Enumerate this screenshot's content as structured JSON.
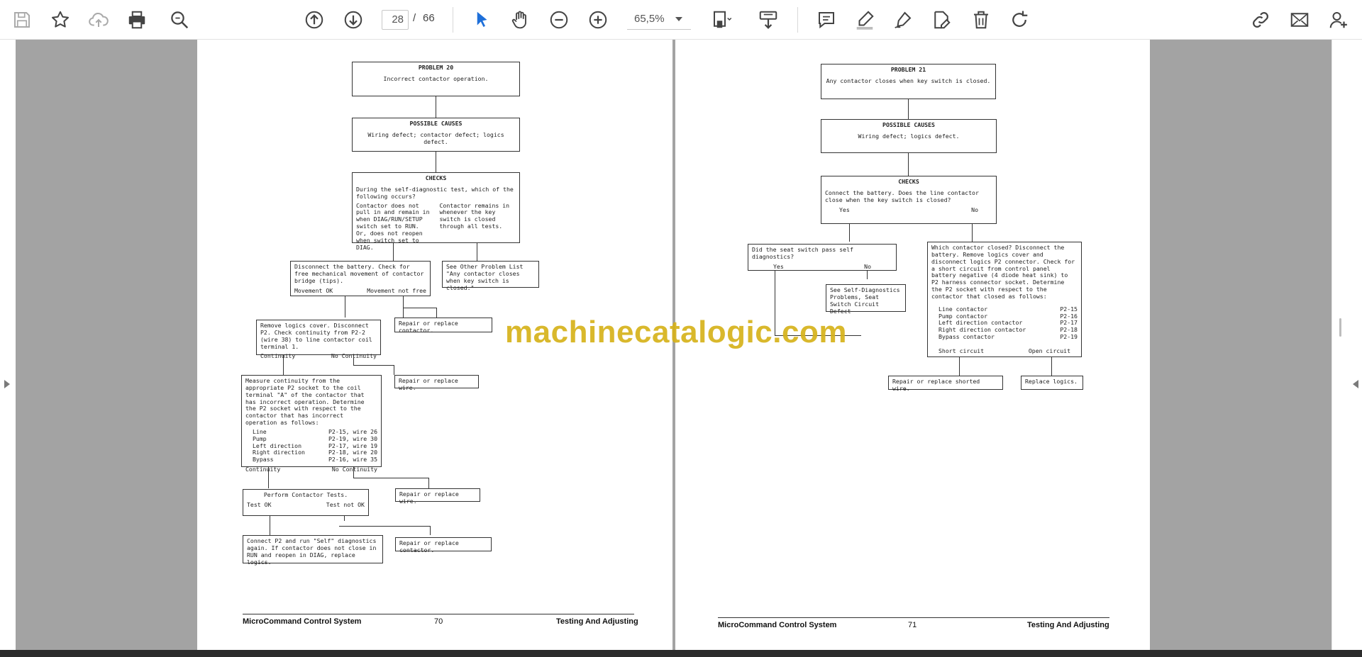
{
  "toolbar": {
    "left_icons": [
      "save-icon",
      "bookmark-star-icon",
      "upload-cloud-icon",
      "print-icon",
      "zoom-search-icon"
    ],
    "nav_icons": [
      "previous-page-icon",
      "next-page-icon"
    ],
    "current_page": "28",
    "separator": "/",
    "total_pages": "66",
    "tool_icons": [
      "select-cursor-icon",
      "hand-pan-icon",
      "zoom-out-icon",
      "zoom-in-icon"
    ],
    "zoom_value": "65,5%",
    "view_icons": [
      "fit-page-icon",
      "download-icon"
    ],
    "annotate_icons": [
      "comment-icon",
      "highlight-pen-icon",
      "sign-icon",
      "edit-doc-icon",
      "delete-icon",
      "redo-icon"
    ],
    "share_icons": [
      "link-icon",
      "email-icon",
      "add-user-icon"
    ],
    "accent_color": "#1e6fd9"
  },
  "watermark": "machinecatalogic.com",
  "left_page": {
    "problem_title": "PROBLEM 20",
    "problem_text": "Incorrect contactor operation.",
    "causes_title": "POSSIBLE CAUSES",
    "causes_text": "Wiring defect; contactor defect; logics defect.",
    "checks_title": "CHECKS",
    "checks_intro": "During the self-diagnostic test, which of the following occurs?",
    "checks_left": "Contactor does not pull in and remain in when DIAG/RUN/SETUP switch set to RUN. Or, does not reopen when switch set to DIAG.",
    "checks_right": "Contactor remains in whenever the key switch is closed through all tests.",
    "disconnect_text": "Disconnect the battery. Check for free mechanical movement of contactor bridge (tips).",
    "movement_ok": "Movement OK",
    "movement_not_free": "Movement not free",
    "see_other_text": "See Other Problem List \"Any contactor closes when key switch is closed.\"",
    "repair_contactor_1": "Repair or replace contactor.",
    "remove_logics_text": "Remove logics cover. Disconnect P2. Check continuity from P2-2 (wire 38) to line contactor coil terminal 1.",
    "continuity_1": "Continuity",
    "no_continuity_1": "No Continuity",
    "repair_wire_1": "Repair or replace wire.",
    "measure_text": "Measure continuity from the appropriate P2 socket to the coil terminal \"A\" of the contactor that has incorrect operation. Determine the P2 socket with respect to the contactor that has incorrect operation as follows:",
    "measure_list": [
      {
        "name": "Line",
        "value": "P2-15, wire 26"
      },
      {
        "name": "Pump",
        "value": "P2-19, wire 30"
      },
      {
        "name": "Left direction",
        "value": "P2-17, wire 19"
      },
      {
        "name": "Right direction",
        "value": "P2-18, wire 20"
      },
      {
        "name": "Bypass",
        "value": "P2-16, wire 35"
      }
    ],
    "continuity_2": "Continuity",
    "no_continuity_2": "No Continuity",
    "perform_text": "Perform Contactor Tests.",
    "test_ok": "Test OK",
    "test_not_ok": "Test not OK",
    "repair_wire_2": "Repair or replace wire.",
    "connect_text": "Connect P2 and run \"Self\" diagnostics again. If contactor does not close in RUN and reopen in DIAG, replace logics.",
    "repair_contactor_2": "Repair or replace contactor.",
    "footer_left": "MicroCommand Control System",
    "footer_page": "70",
    "footer_right": "Testing And Adjusting"
  },
  "right_page": {
    "problem_title": "PROBLEM 21",
    "problem_text": "Any contactor closes when key switch is closed.",
    "causes_title": "POSSIBLE CAUSES",
    "causes_text": "Wiring defect; logics defect.",
    "checks_title": "CHECKS",
    "checks_text": "Connect the battery. Does the line contactor close when the key switch is closed?",
    "yes": "Yes",
    "no": "No",
    "seat_text": "Did the seat switch pass self diagnostics?",
    "seat_yes": "Yes",
    "seat_no": "No",
    "see_self_text": "See Self-Diagnostics Problems, Seat Switch Circuit Defect",
    "which_text": "Which contactor closed? Disconnect the battery. Remove logics cover and disconnect logics P2 connector. Check for a short circuit from control panel battery negative (4 diode heat sink) to P2 harness connector socket. Determine the P2 socket with respect to the contactor that closed as follows:",
    "which_list": [
      {
        "name": "Line contactor",
        "value": "P2-15"
      },
      {
        "name": "Pump contactor",
        "value": "P2-16"
      },
      {
        "name": "Left direction contactor",
        "value": "P2-17"
      },
      {
        "name": "Right direction contactor",
        "value": "P2-18"
      },
      {
        "name": "Bypass contactor",
        "value": "P2-19"
      }
    ],
    "short_circuit": "Short circuit",
    "open_circuit": "Open circuit",
    "repair_shorted": "Repair or replace shorted wire.",
    "replace_logics": "Replace logics.",
    "footer_left": "MicroCommand Control System",
    "footer_page": "71",
    "footer_right": "Testing And Adjusting"
  }
}
